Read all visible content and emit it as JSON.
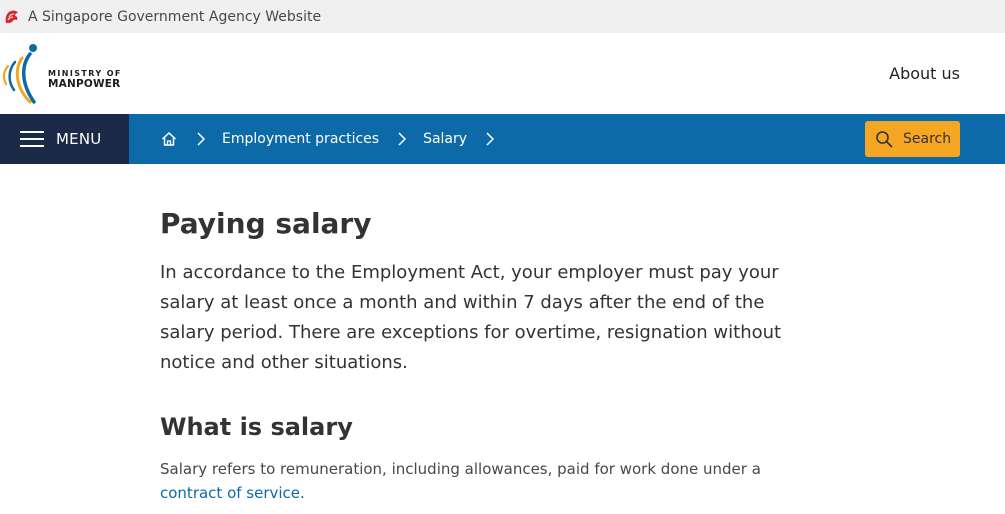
{
  "gov_banner": {
    "text": "A Singapore Government Agency Website",
    "icon": "lion-head-icon"
  },
  "header": {
    "logo": {
      "line1": "MINISTRY OF",
      "line2": "MANPOWER"
    },
    "about_label": "About us"
  },
  "navbar": {
    "menu_label": "MENU",
    "breadcrumb": [
      {
        "label": "Employment practices"
      },
      {
        "label": "Salary"
      }
    ],
    "search_label": "Search"
  },
  "content": {
    "title": "Paying salary",
    "lead": "In accordance to the Employment Act, your employer must pay your salary at least once a month and within 7 days after the end of the salary period. There are exceptions for overtime, resignation without notice and other situations.",
    "section_heading": "What is salary",
    "section_text_before_link": "Salary refers to remuneration, including allowances, paid for work done under a ",
    "section_link": "contract of service",
    "section_text_after_link": "."
  },
  "colors": {
    "nav_blue": "#0d6aa8",
    "menu_navy": "#1b2a47",
    "search_orange": "#f5a623",
    "gov_red": "#d9262c"
  }
}
